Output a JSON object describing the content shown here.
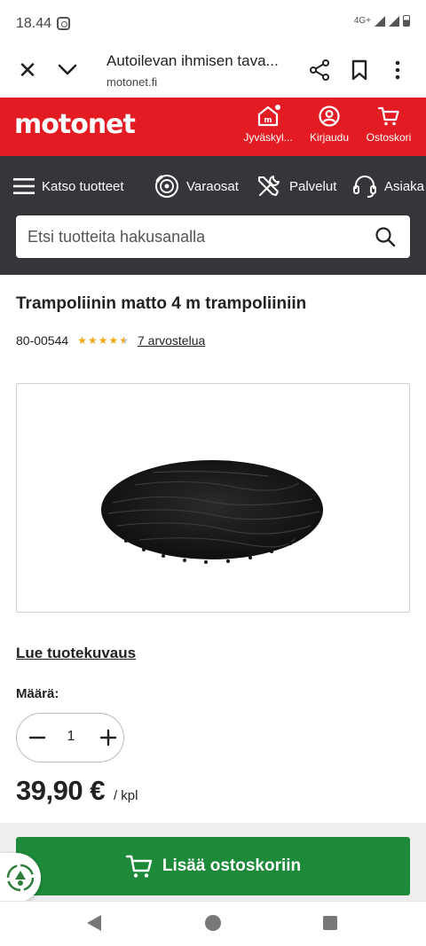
{
  "status_bar": {
    "time": "18.44",
    "network": "4G+"
  },
  "browser": {
    "page_title": "Autoilevan ihmisen tava...",
    "domain": "motonet.fi"
  },
  "header": {
    "logo": "motonet",
    "store_label": "Jyväskyl...",
    "login_label": "Kirjaudu",
    "cart_label": "Ostoskori",
    "brand_color": "#e31b23"
  },
  "nav": {
    "items": [
      {
        "label": "Katso tuotteet",
        "icon": "hamburger-menu-icon"
      },
      {
        "label": "Varaosat",
        "icon": "brake-disc-icon"
      },
      {
        "label": "Palvelut",
        "icon": "tools-icon"
      },
      {
        "label": "Asiaka",
        "icon": "headset-icon"
      }
    ],
    "search_placeholder": "Etsi tuotteita hakusanalla"
  },
  "product": {
    "title": "Trampoliinin matto 4 m trampoliiniin",
    "sku": "80-00544",
    "rating": 4.5,
    "rating_max": 5,
    "reviews_link": "7 arvostelua",
    "read_description": "Lue tuotekuvaus",
    "quantity_label": "Määrä:",
    "quantity": "1",
    "price": "39,90 €",
    "price_unit": "/ kpl",
    "add_to_cart": "Lisää ostoskoriin",
    "add_to_cart_color": "#1d8a3a"
  }
}
